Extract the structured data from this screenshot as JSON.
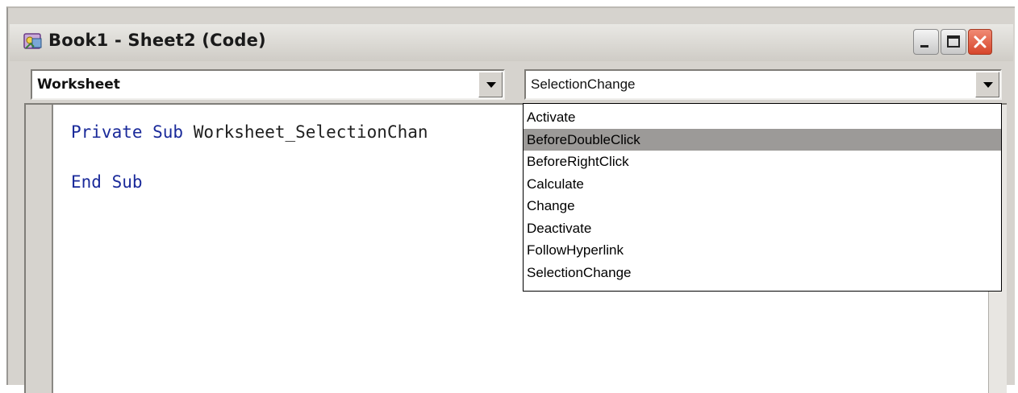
{
  "window": {
    "title": "Book1 - Sheet2 (Code)"
  },
  "object_combo": {
    "value": "Worksheet"
  },
  "procedure_combo": {
    "value": "SelectionChange",
    "options": [
      {
        "label": "Activate",
        "selected": false
      },
      {
        "label": "BeforeDoubleClick",
        "selected": true
      },
      {
        "label": "BeforeRightClick",
        "selected": false
      },
      {
        "label": "Calculate",
        "selected": false
      },
      {
        "label": "Change",
        "selected": false
      },
      {
        "label": "Deactivate",
        "selected": false
      },
      {
        "label": "FollowHyperlink",
        "selected": false
      },
      {
        "label": "SelectionChange",
        "selected": false
      }
    ]
  },
  "code": {
    "line1_kw": "Private Sub",
    "line1_rest": " Worksheet_SelectionChan",
    "line2_kw": "End Sub"
  },
  "colors": {
    "keyword": "#1a2a9a",
    "highlight": "#9c9a98",
    "close_button": "#d6452a"
  },
  "icons": {
    "app": "vba-project-icon",
    "minimize": "minimize-icon",
    "maximize": "maximize-icon",
    "close": "close-icon",
    "dropdown": "chevron-down-icon"
  }
}
